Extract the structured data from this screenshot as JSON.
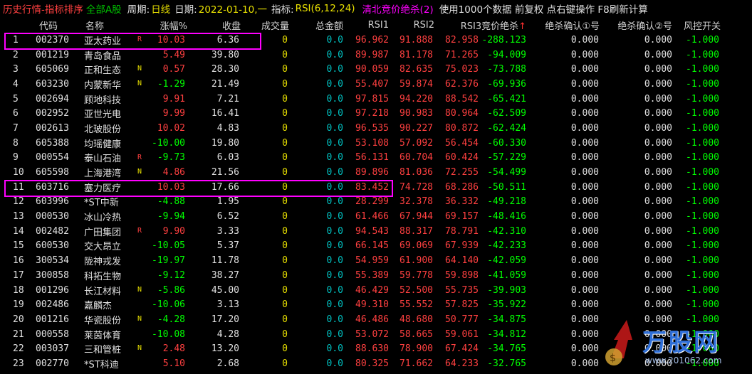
{
  "titlebar": {
    "section": "历史行情-指标排序",
    "flag": "全部A股",
    "period_label": "周期:",
    "period_value": "日线",
    "date_label": "日期:",
    "date_value": "2022-01-10,一",
    "indicator_label": "指标:",
    "indicator_value": "RSI(6,12,24)",
    "formula": "清北竞价绝杀(2)",
    "hint": "使用1000个数据 前复权 点右键操作 F8刷新计算"
  },
  "columns": {
    "code": "代码",
    "name": "名称",
    "pct": "涨幅%",
    "close": "收盘",
    "volume": "成交量",
    "amount": "总金额",
    "rsi1": "RSI1",
    "rsi2": "RSI2",
    "rsi3": "RSI3竞价绝杀",
    "sort_arrow": "↑",
    "confirm1": "绝杀确认①号",
    "confirm2": "绝杀确认②号",
    "risk": "风控开关"
  },
  "rows": [
    {
      "idx": "1",
      "code": "002370",
      "name": "亚太药业",
      "tag": "R",
      "pct": "10.03",
      "close": "6.36",
      "vol": "0",
      "amt": "0.0",
      "rsi1": "96.962",
      "rsi2": "91.888",
      "rsi3": "82.958",
      "sig": "-288.123",
      "a1": "0.000",
      "a2": "0.000",
      "risk": "-1.000"
    },
    {
      "idx": "2",
      "code": "001219",
      "name": "青岛食品",
      "tag": "",
      "pct": "5.49",
      "close": "39.80",
      "vol": "0",
      "amt": "0.0",
      "rsi1": "89.987",
      "rsi2": "81.178",
      "rsi3": "71.265",
      "sig": "-94.009",
      "a1": "0.000",
      "a2": "0.000",
      "risk": "-1.000"
    },
    {
      "idx": "3",
      "code": "605069",
      "name": "正和生态",
      "tag": "N",
      "pct": "0.57",
      "close": "28.30",
      "vol": "0",
      "amt": "0.0",
      "rsi1": "90.059",
      "rsi2": "82.635",
      "rsi3": "75.023",
      "sig": "-73.788",
      "a1": "0.000",
      "a2": "0.000",
      "risk": "-1.000"
    },
    {
      "idx": "4",
      "code": "603230",
      "name": "内蒙新华",
      "tag": "N",
      "pct": "-1.29",
      "close": "21.49",
      "vol": "0",
      "amt": "0.0",
      "rsi1": "55.407",
      "rsi2": "59.874",
      "rsi3": "62.376",
      "sig": "-69.936",
      "a1": "0.000",
      "a2": "0.000",
      "risk": "-1.000"
    },
    {
      "idx": "5",
      "code": "002694",
      "name": "顾地科技",
      "tag": "",
      "pct": "9.91",
      "close": "7.21",
      "vol": "0",
      "amt": "0.0",
      "rsi1": "97.815",
      "rsi2": "94.220",
      "rsi3": "88.542",
      "sig": "-65.421",
      "a1": "0.000",
      "a2": "0.000",
      "risk": "-1.000"
    },
    {
      "idx": "6",
      "code": "002952",
      "name": "亚世光电",
      "tag": "",
      "pct": "9.99",
      "close": "16.41",
      "vol": "0",
      "amt": "0.0",
      "rsi1": "97.218",
      "rsi2": "90.983",
      "rsi3": "80.964",
      "sig": "-62.509",
      "a1": "0.000",
      "a2": "0.000",
      "risk": "-1.000"
    },
    {
      "idx": "7",
      "code": "002613",
      "name": "北玻股份",
      "tag": "",
      "pct": "10.02",
      "close": "4.83",
      "vol": "0",
      "amt": "0.0",
      "rsi1": "96.535",
      "rsi2": "90.227",
      "rsi3": "80.872",
      "sig": "-62.424",
      "a1": "0.000",
      "a2": "0.000",
      "risk": "-1.000"
    },
    {
      "idx": "8",
      "code": "605388",
      "name": "均瑶健康",
      "tag": "",
      "pct": "-10.00",
      "close": "19.80",
      "vol": "0",
      "amt": "0.0",
      "rsi1": "53.108",
      "rsi2": "57.092",
      "rsi3": "56.454",
      "sig": "-60.330",
      "a1": "0.000",
      "a2": "0.000",
      "risk": "-1.000"
    },
    {
      "idx": "9",
      "code": "000554",
      "name": "泰山石油",
      "tag": "R",
      "pct": "-9.73",
      "close": "6.03",
      "vol": "0",
      "amt": "0.0",
      "rsi1": "56.131",
      "rsi2": "60.704",
      "rsi3": "60.424",
      "sig": "-57.229",
      "a1": "0.000",
      "a2": "0.000",
      "risk": "-1.000"
    },
    {
      "idx": "10",
      "code": "605598",
      "name": "上海港湾",
      "tag": "N",
      "pct": "4.86",
      "close": "21.56",
      "vol": "0",
      "amt": "0.0",
      "rsi1": "89.896",
      "rsi2": "81.036",
      "rsi3": "72.255",
      "sig": "-54.499",
      "a1": "0.000",
      "a2": "0.000",
      "risk": "-1.000"
    },
    {
      "idx": "11",
      "code": "603716",
      "name": "塞力医疗",
      "tag": "",
      "pct": "10.03",
      "close": "17.66",
      "vol": "0",
      "amt": "0.0",
      "rsi1": "83.452",
      "rsi2": "74.728",
      "rsi3": "68.286",
      "sig": "-50.511",
      "a1": "0.000",
      "a2": "0.000",
      "risk": "-1.000"
    },
    {
      "idx": "12",
      "code": "603996",
      "name": "*ST中新",
      "tag": "",
      "pct": "-4.88",
      "close": "1.95",
      "vol": "0",
      "amt": "0.0",
      "rsi1": "28.299",
      "rsi2": "32.378",
      "rsi3": "36.332",
      "sig": "-49.218",
      "a1": "0.000",
      "a2": "0.000",
      "risk": "-1.000"
    },
    {
      "idx": "13",
      "code": "000530",
      "name": "冰山冷热",
      "tag": "",
      "pct": "-9.94",
      "close": "6.52",
      "vol": "0",
      "amt": "0.0",
      "rsi1": "61.466",
      "rsi2": "67.944",
      "rsi3": "69.157",
      "sig": "-48.416",
      "a1": "0.000",
      "a2": "0.000",
      "risk": "-1.000"
    },
    {
      "idx": "14",
      "code": "002482",
      "name": "广田集团",
      "tag": "R",
      "pct": "9.90",
      "close": "3.33",
      "vol": "0",
      "amt": "0.0",
      "rsi1": "94.543",
      "rsi2": "88.317",
      "rsi3": "78.791",
      "sig": "-42.310",
      "a1": "0.000",
      "a2": "0.000",
      "risk": "-1.000"
    },
    {
      "idx": "15",
      "code": "600530",
      "name": "交大昂立",
      "tag": "",
      "pct": "-10.05",
      "close": "5.37",
      "vol": "0",
      "amt": "0.0",
      "rsi1": "66.145",
      "rsi2": "69.069",
      "rsi3": "67.939",
      "sig": "-42.233",
      "a1": "0.000",
      "a2": "0.000",
      "risk": "-1.000"
    },
    {
      "idx": "16",
      "code": "300534",
      "name": "陇神戎发",
      "tag": "",
      "pct": "-19.97",
      "close": "11.78",
      "vol": "0",
      "amt": "0.0",
      "rsi1": "54.959",
      "rsi2": "61.900",
      "rsi3": "64.140",
      "sig": "-42.059",
      "a1": "0.000",
      "a2": "0.000",
      "risk": "-1.000"
    },
    {
      "idx": "17",
      "code": "300858",
      "name": "科拓生物",
      "tag": "",
      "pct": "-9.12",
      "close": "38.27",
      "vol": "0",
      "amt": "0.0",
      "rsi1": "55.389",
      "rsi2": "59.778",
      "rsi3": "59.898",
      "sig": "-41.059",
      "a1": "0.000",
      "a2": "0.000",
      "risk": "-1.000"
    },
    {
      "idx": "18",
      "code": "001296",
      "name": "长江材料",
      "tag": "N",
      "pct": "-5.86",
      "close": "45.00",
      "vol": "0",
      "amt": "0.0",
      "rsi1": "46.429",
      "rsi2": "52.500",
      "rsi3": "55.735",
      "sig": "-39.903",
      "a1": "0.000",
      "a2": "0.000",
      "risk": "-1.000"
    },
    {
      "idx": "19",
      "code": "002486",
      "name": "嘉麟杰",
      "tag": "",
      "pct": "-10.06",
      "close": "3.13",
      "vol": "0",
      "amt": "0.0",
      "rsi1": "49.310",
      "rsi2": "55.552",
      "rsi3": "57.825",
      "sig": "-35.922",
      "a1": "0.000",
      "a2": "0.000",
      "risk": "-1.000"
    },
    {
      "idx": "20",
      "code": "001216",
      "name": "华瓷股份",
      "tag": "N",
      "pct": "-4.28",
      "close": "17.20",
      "vol": "0",
      "amt": "0.0",
      "rsi1": "46.486",
      "rsi2": "48.680",
      "rsi3": "50.777",
      "sig": "-34.875",
      "a1": "0.000",
      "a2": "0.000",
      "risk": "-1.000"
    },
    {
      "idx": "21",
      "code": "000558",
      "name": "莱茵体育",
      "tag": "",
      "pct": "-10.08",
      "close": "4.28",
      "vol": "0",
      "amt": "0.0",
      "rsi1": "53.072",
      "rsi2": "58.665",
      "rsi3": "59.061",
      "sig": "-34.812",
      "a1": "0.000",
      "a2": "0.000",
      "risk": "-1.000"
    },
    {
      "idx": "22",
      "code": "003037",
      "name": "三和管桩",
      "tag": "N",
      "pct": "2.48",
      "close": "13.20",
      "vol": "0",
      "amt": "0.0",
      "rsi1": "88.630",
      "rsi2": "78.900",
      "rsi3": "67.424",
      "sig": "-34.765",
      "a1": "0.000",
      "a2": "0.000",
      "risk": "-1.000"
    },
    {
      "idx": "23",
      "code": "002770",
      "name": "*ST科迪",
      "tag": "",
      "pct": "5.10",
      "close": "2.68",
      "vol": "0",
      "amt": "0.0",
      "rsi1": "80.325",
      "rsi2": "71.662",
      "rsi3": "64.233",
      "sig": "-32.765",
      "a1": "0.000",
      "a2": "0.000",
      "risk": "-1.000"
    }
  ],
  "watermark": {
    "brand": "万股网",
    "url": "www.201062.com"
  },
  "colors": {
    "up": "#ff4040",
    "down": "#00ff00",
    "highlight": "#ff00ff"
  }
}
